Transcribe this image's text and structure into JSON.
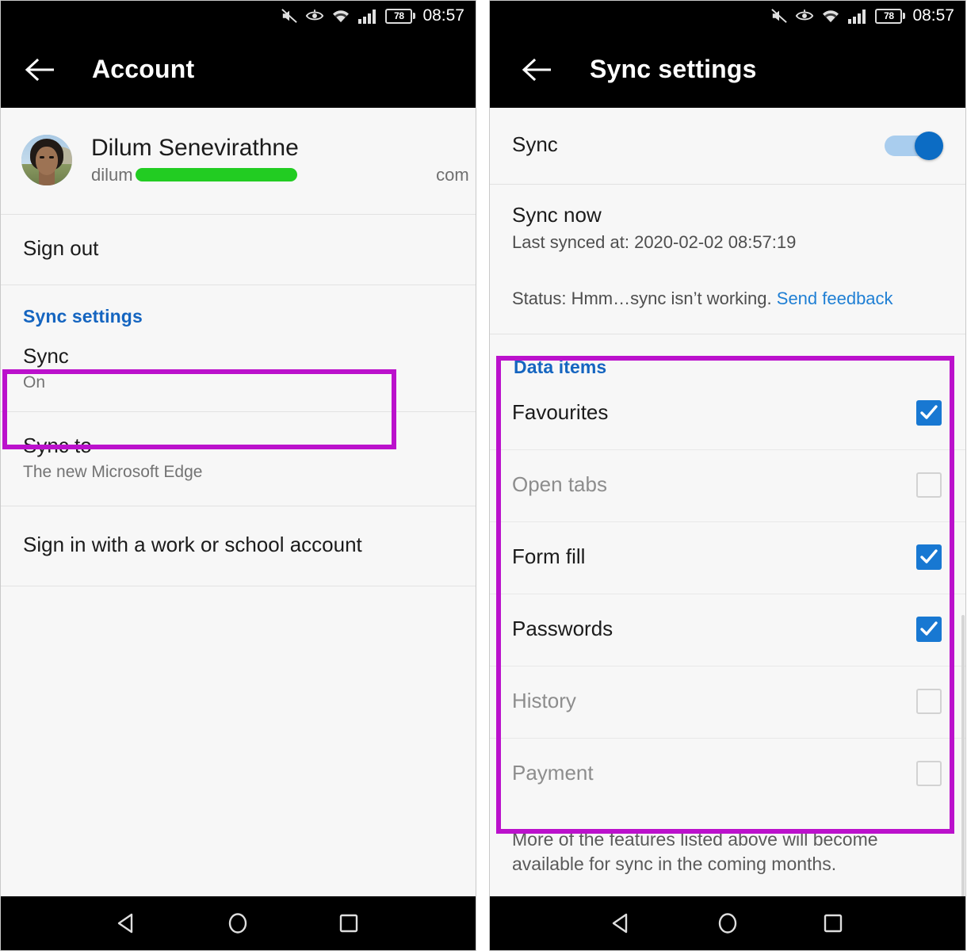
{
  "status_bar": {
    "icons": [
      "mute-icon",
      "eye-comfort-icon",
      "wifi-icon",
      "signal-icon"
    ],
    "battery_level": "78",
    "time": "08:57"
  },
  "colors": {
    "accent_blue": "#1565c0",
    "link_blue": "#1f7fd4",
    "toggle_on": "#0c6cc4",
    "checkbox_on": "#1878d2",
    "annotation_purple": "#bb11cc",
    "redaction_green": "#22cc22",
    "app_bar_black": "#000000",
    "page_background": "#f7f7f7"
  },
  "left_screen": {
    "app_bar": {
      "title": "Account",
      "back_label": "Back"
    },
    "account": {
      "name": "Dilum Senevirathne",
      "email_prefix": "dilum",
      "email_suffix": "com",
      "email_redacted": true,
      "avatar_name": "Dilum Senevirathne"
    },
    "rows": [
      {
        "title": "Sign out"
      }
    ],
    "section_label": "Sync settings",
    "sync_row": {
      "title": "Sync",
      "subtitle": "On",
      "highlighted": true
    },
    "sync_to_row": {
      "title": "Sync to",
      "subtitle": "The new Microsoft Edge"
    },
    "work_account_row": {
      "title": "Sign in with a work or school account"
    }
  },
  "right_screen": {
    "app_bar": {
      "title": "Sync settings",
      "back_label": "Back"
    },
    "sync_toggle": {
      "label": "Sync",
      "state": "on"
    },
    "sync_now": {
      "title": "Sync now",
      "last_synced": "Last synced at: 2020-02-02 08:57:19",
      "status_prefix": "Status: Hmm…sync isn’t working.",
      "feedback_link": "Send feedback"
    },
    "data_items": {
      "section_label": "Data items",
      "highlighted": true,
      "items": [
        {
          "label": "Favourites",
          "checked": true,
          "disabled": false
        },
        {
          "label": "Open tabs",
          "checked": false,
          "disabled": true
        },
        {
          "label": "Form fill",
          "checked": true,
          "disabled": false
        },
        {
          "label": "Passwords",
          "checked": true,
          "disabled": false
        },
        {
          "label": "History",
          "checked": false,
          "disabled": true
        },
        {
          "label": "Payment",
          "checked": false,
          "disabled": true
        }
      ]
    },
    "footer_note": "More of the features listed above will become available for sync in the coming months."
  },
  "nav_bar": {
    "back": "back-triangle-icon",
    "home": "home-circle-icon",
    "recents": "recents-square-icon"
  }
}
